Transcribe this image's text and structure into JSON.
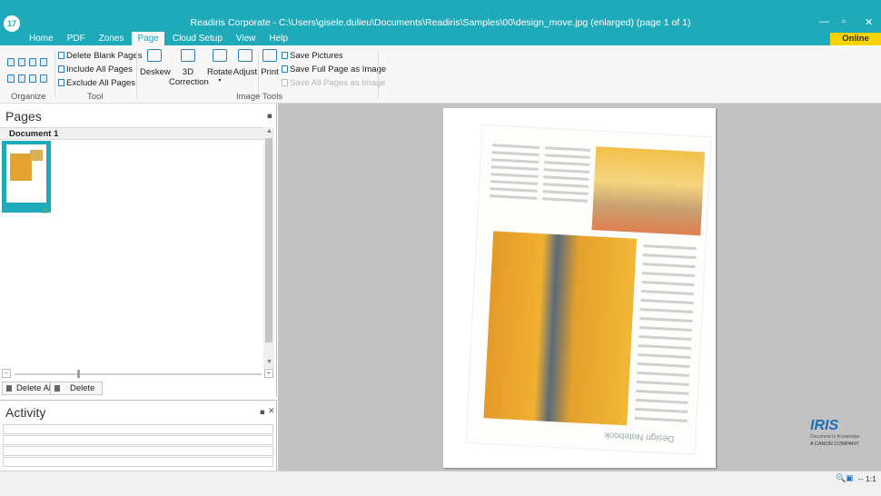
{
  "window": {
    "badge": "17",
    "title": "Readiris Corporate - C:\\Users\\gisele.dulieu\\Documents\\Readiris\\Samples\\00\\design_move.jpg (enlarged) (page 1 of 1)",
    "min": "—",
    "max": "▫",
    "close": "✕"
  },
  "tabs": [
    "Home",
    "PDF",
    "Zones",
    "Page",
    "Cloud Setup",
    "View",
    "Help"
  ],
  "online_store": "Online Store",
  "ribbon": {
    "groups": {
      "organize": "Organize",
      "tool": "Tool",
      "image_tools": "Image Tools"
    },
    "tool_cmds": [
      "Delete Blank Pages",
      "Include All Pages",
      "Exclude All Pages"
    ],
    "big_cmds": {
      "deskew": "Deskew",
      "correction_top": "3D",
      "correction_bottom": "Correction",
      "rotate": "Rotate",
      "adjust": "Adjust",
      "print": "Print"
    },
    "save_cmds": [
      "Save Pictures",
      "Save Full Page as Image",
      "Save All Pages as Image"
    ]
  },
  "pages_panel": {
    "title": "Pages",
    "document": "Document 1",
    "delete_all": "Delete All",
    "delete": "Delete"
  },
  "activity": {
    "title": "Activity"
  },
  "scan": {
    "brand": "Design Notebook"
  },
  "iris": {
    "word": "IRIS",
    "sub": "Document to Knowledge",
    "canon": "A CANON COMPANY"
  },
  "status": {
    "zoom_text": "1:1"
  },
  "colors": {
    "accent": "#1eaab8",
    "store": "#f5d200",
    "viewer_bg": "#c2c2c2"
  }
}
